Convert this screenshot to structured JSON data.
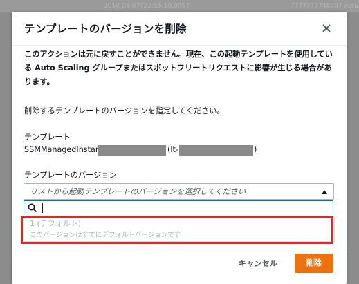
{
  "backdrop": {
    "left_text": "2014-08-07T22:55:10.0057",
    "right_text": "7777777748007 assun"
  },
  "modal": {
    "title": "テンプレートのバージョンを削除",
    "close_icon": "close-icon",
    "warning": "このアクションは元に戻すことができません。現在、この起動テンプレートを使用している Auto Scaling グループまたはスポットフリートリクエストに影響が生じる場合があります。",
    "instruction": "削除するテンプレートのバージョンを指定してください。",
    "template_label": "テンプレート",
    "template_name_prefix": "SSMManagedInstar",
    "template_id_prefix": "(lt-",
    "template_id_suffix": ")",
    "version_label": "テンプレートのバージョン",
    "version_select": {
      "placeholder": "リストから起動テンプレートのバージョンを選択してください",
      "search_icon": "search-icon",
      "search_value": "",
      "options": [
        {
          "label": "1 (デフォルト)",
          "description": "このバージョンはすでにデフォルトバージョンです",
          "disabled": true
        }
      ]
    },
    "cancel_label": "キャンセル",
    "delete_label": "削除"
  },
  "colors": {
    "accent": "#ec7211",
    "focus": "#0073bb",
    "highlight": "#e8251f"
  }
}
